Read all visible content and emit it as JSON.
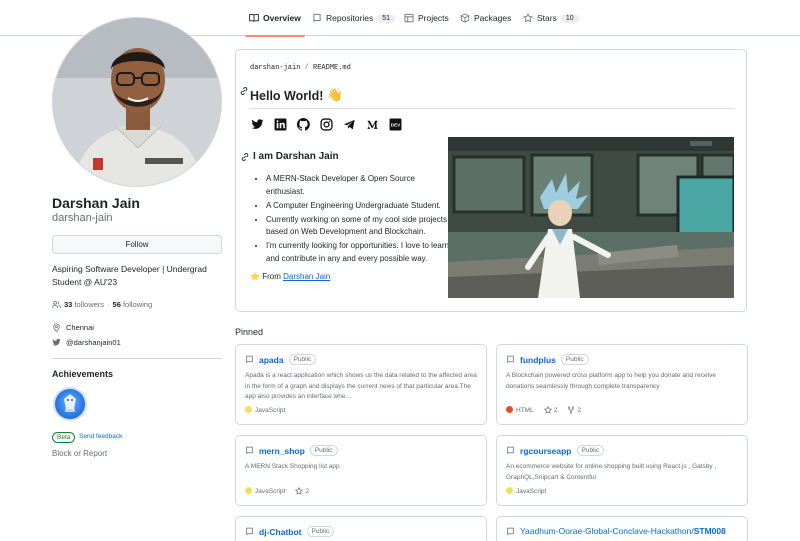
{
  "tabs": [
    {
      "label": "Overview",
      "icon": "book-icon",
      "selected": true
    },
    {
      "label": "Repositories",
      "icon": "repo-icon",
      "count": "51"
    },
    {
      "label": "Projects",
      "icon": "table-icon"
    },
    {
      "label": "Packages",
      "icon": "package-icon"
    },
    {
      "label": "Stars",
      "icon": "star-icon",
      "count": "10"
    }
  ],
  "profile": {
    "name": "Darshan Jain",
    "login": "darshan-jain",
    "follow_label": "Follow",
    "bio": "Aspiring Software Developer | Undergrad Student @ AU'23",
    "followers": "33",
    "followers_label": "followers",
    "following": "56",
    "following_label": "following",
    "dot": "·",
    "location": "Chennai",
    "twitter": "@darshanjain01"
  },
  "achievements": {
    "title": "Achievements",
    "beta_label": "Beta",
    "feedback_label": "Send feedback",
    "block_label": "Block or Report"
  },
  "readme": {
    "path_user": "darshan-jain",
    "path_sep": "/",
    "path_file": "README.md",
    "heading": "Hello World!",
    "heading_emoji": "👋",
    "socials": [
      "twitter-icon",
      "linkedin-icon",
      "github-icon",
      "instagram-icon",
      "telegram-icon",
      "medium-icon",
      "devto-icon"
    ],
    "subheading": "I am Darshan Jain",
    "bullets": [
      "A MERN-Stack Developer & Open Source enthusiast.",
      "A Computer Engineering Undergraduate Student.",
      "Currently working on some of my cool side projects based on Web Development and Blockchain.",
      "I'm currently looking for opportunities. I love to learn and contribute in any and every possible way."
    ],
    "from_star": "⭐",
    "from_prefix": "From",
    "from_link": "Darshan Jain"
  },
  "pinned": {
    "title": "Pinned",
    "visibility_label": "Public",
    "repos": [
      {
        "name": "apada",
        "desc": "Apada is a react application which shows us the data related to the affected area in the form of a graph and displays the current news of that particular area.The app also provides an interface whe…",
        "lang": "JavaScript",
        "lang_color": "#f1e05a"
      },
      {
        "name": "fundplus",
        "desc": "A Blockchain powered cross platform app to help you donate and receive donations seamlessly through complete transparency",
        "lang": "HTML",
        "lang_color": "#e34c26",
        "stars": "2",
        "forks": "2"
      },
      {
        "name": "mern_shop",
        "desc": "A MERN Stack Shopping list app",
        "lang": "JavaScript",
        "lang_color": "#f1e05a",
        "stars": "2"
      },
      {
        "name": "rgcourseapp",
        "desc": "An ecommerce website for online shopping built using React.js , Gatsby , GraphQL,Snipcart & Contentful",
        "lang": "JavaScript",
        "lang_color": "#f1e05a"
      },
      {
        "name": "dj-Chatbot"
      },
      {
        "name_owner": "Yaadhum-Oorae-Global-Conclave-Hackathon/",
        "name": "STM008"
      }
    ]
  }
}
